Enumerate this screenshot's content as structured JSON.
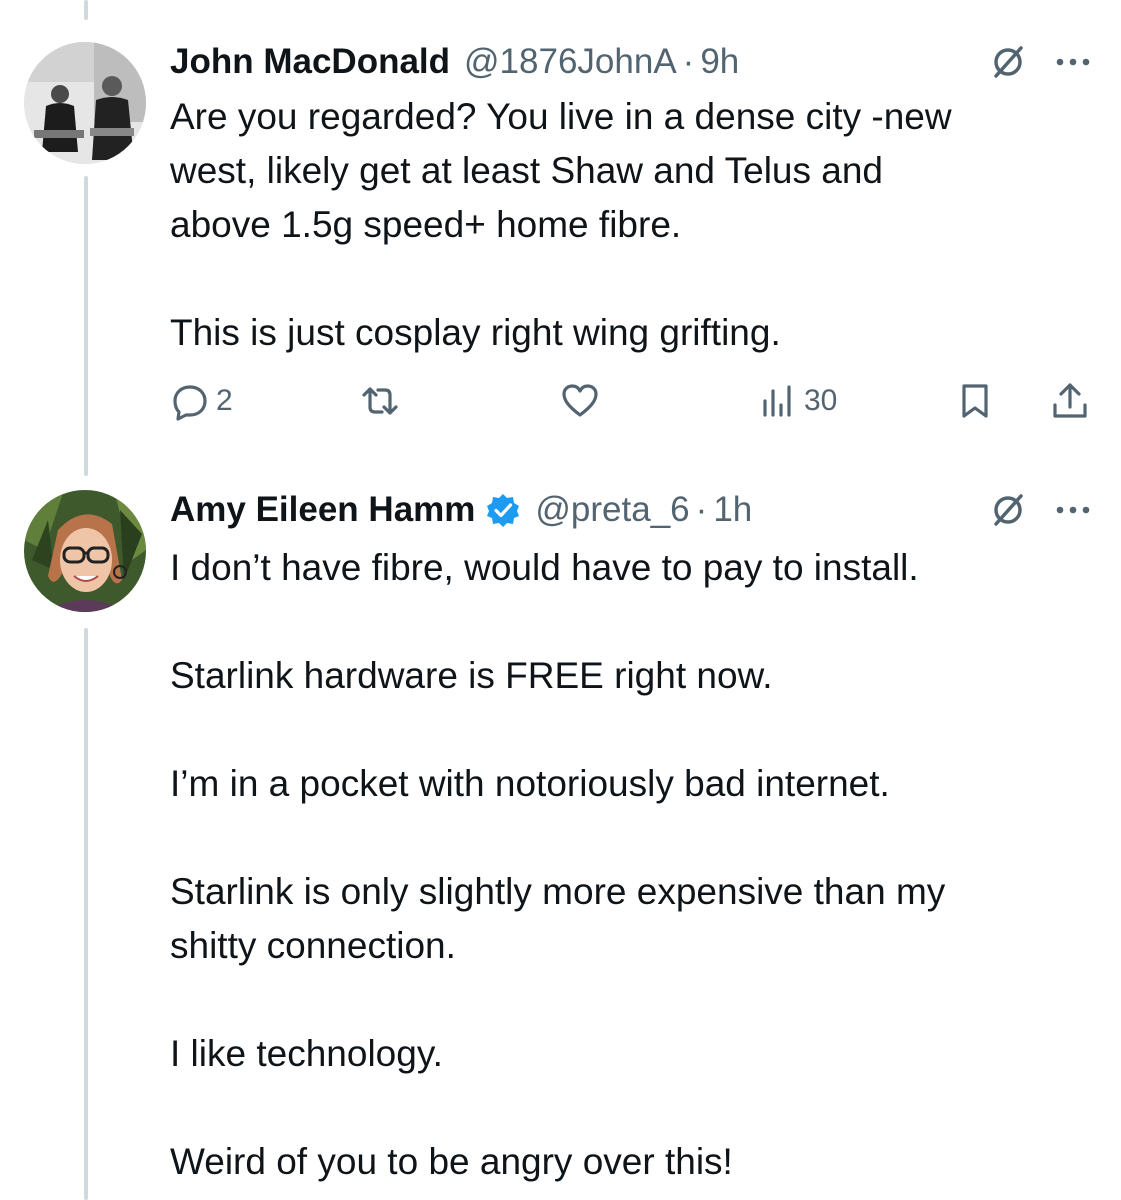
{
  "tweets": [
    {
      "name": "John MacDonald",
      "handle": "@1876JohnA",
      "separator": "·",
      "time": "9h",
      "verified": false,
      "lines": [
        "Are you regarded? You live in a dense city -new",
        "west, likely get at least  Shaw and Telus and",
        "above 1.5g speed+ home fibre.",
        "",
        "This is just cosplay right wing  grifting."
      ],
      "replies": "2",
      "retweets": "",
      "likes": "",
      "views": "30"
    },
    {
      "name": "Amy Eileen Hamm",
      "handle": "@preta_6",
      "separator": "·",
      "time": "1h",
      "verified": true,
      "lines": [
        "I don’t have fibre, would have to pay to install.",
        "",
        "Starlink hardware is FREE right now.",
        "",
        "I’m in a pocket with notoriously bad internet.",
        "",
        "Starlink is only slightly more expensive than my",
        "shitty connection.",
        "",
        "I like technology.",
        "",
        "Weird of you to be angry over this!"
      ]
    }
  ],
  "colors": {
    "text": "#0f1419",
    "secondary": "#536471",
    "verified": "#1d9bf0",
    "thread_line": "#cfd9de"
  },
  "icons": [
    "reply-icon",
    "retweet-icon",
    "like-icon",
    "views-icon",
    "bookmark-icon",
    "share-icon",
    "grok-icon",
    "more-icon",
    "verified-badge-icon"
  ]
}
